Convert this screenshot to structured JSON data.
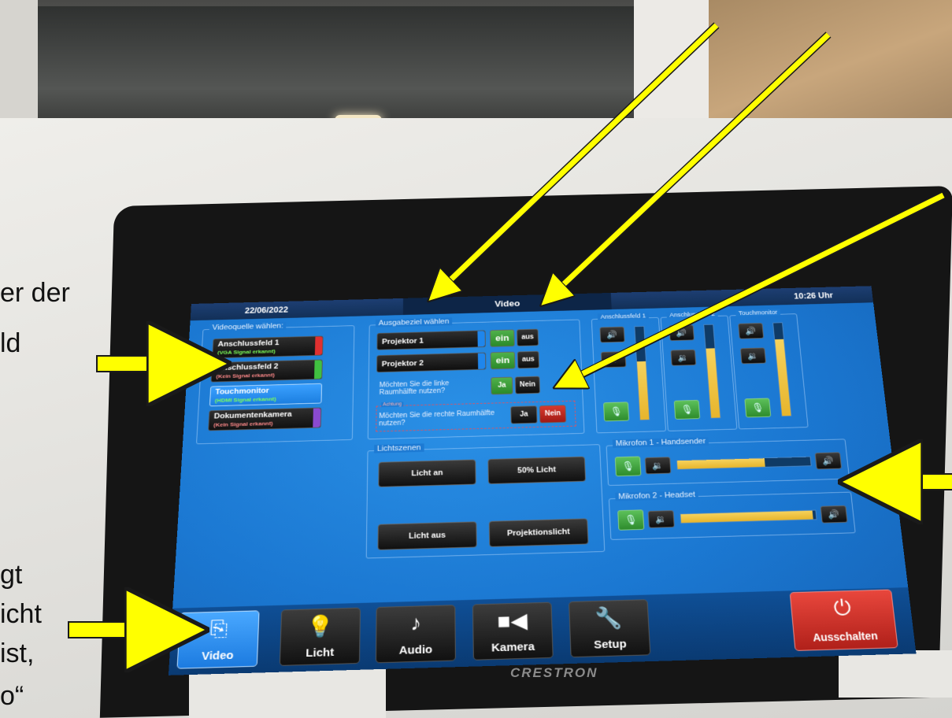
{
  "header": {
    "date": "22/06/2022",
    "title": "Video",
    "time": "10:26 Uhr"
  },
  "sources": {
    "label": "Videoquelle wählen:",
    "items": [
      {
        "name": "Anschlussfeld 1",
        "status": "(VGA Signal erkannt)",
        "status_color": "#7dff5a",
        "bar_color": "#e03030"
      },
      {
        "name": "Anschlussfeld 2",
        "status": "(Kein Signal erkannt)",
        "status_color": "#ff8a8a",
        "bar_color": "#40c040"
      },
      {
        "name": "Touchmonitor",
        "status": "(HDMI Signal erkannt)",
        "status_color": "#7dff5a",
        "bar_color": "#1c7fe0"
      },
      {
        "name": "Dokumentenkamera",
        "status": "(Kein Signal erkannt)",
        "status_color": "#ff8a8a",
        "bar_color": "#8a4ad0"
      }
    ]
  },
  "outputs": {
    "label": "Ausgabeziel wählen",
    "projectors": [
      {
        "name": "Projektor 1",
        "on": "ein",
        "off": "aus"
      },
      {
        "name": "Projektor 2",
        "on": "ein",
        "off": "aus"
      }
    ],
    "q_left": "Möchten Sie die linke Raumhälfte nutzen?",
    "q_right": "Möchten Sie die rechte Raumhälfte nutzen?",
    "warning": "Achtung",
    "yes": "Ja",
    "no": "Nein"
  },
  "light": {
    "label": "Lichtszenen",
    "buttons": [
      "Licht an",
      "50% Licht",
      "Licht aus",
      "Projektionslicht"
    ]
  },
  "audio": {
    "channels": [
      {
        "label": "Anschlussfeld 1",
        "level": 0.62
      },
      {
        "label": "Anschlussfeld 2",
        "level": 0.74
      },
      {
        "label": "Touchmonitor",
        "level": 0.82
      }
    ],
    "mics": [
      {
        "label": "Mikrofon 1 - Handsender",
        "level": 0.66
      },
      {
        "label": "Mikrofon 2 - Headset",
        "level": 0.98
      }
    ]
  },
  "nav": {
    "items": [
      "Video",
      "Licht",
      "Audio",
      "Kamera",
      "Setup"
    ],
    "power": "Ausschalten"
  },
  "device": {
    "brand": "CRESTRON"
  },
  "overlay_text": {
    "line1": "er der",
    "line2": "ld",
    "line3": "gt",
    "line4": "icht",
    "line5": "ist,",
    "line6": "o“"
  },
  "colors": {
    "screen_blue": "#1b78d2",
    "arrow_yellow": "#ffff00",
    "power_red": "#d83a2e"
  }
}
